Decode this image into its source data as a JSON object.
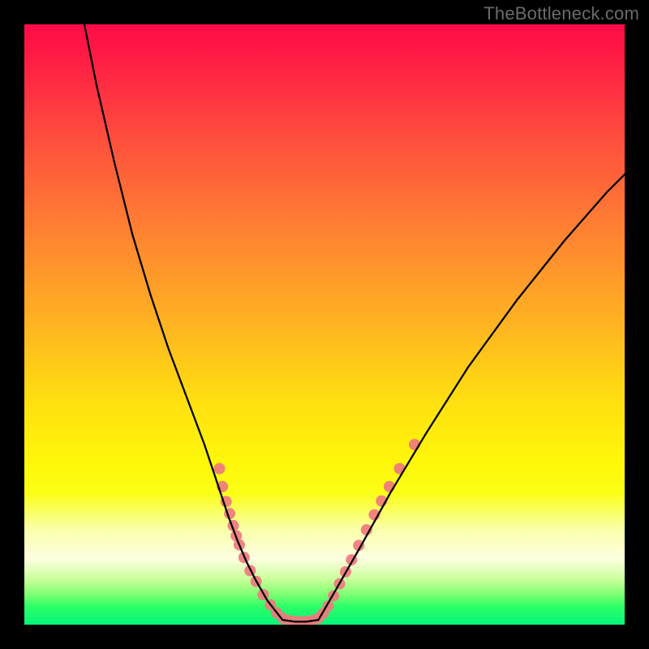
{
  "watermark": "TheBottleneck.com",
  "chart_data": {
    "type": "line",
    "title": "",
    "xlabel": "",
    "ylabel": "",
    "xlim": [
      0,
      100
    ],
    "ylim": [
      0,
      100
    ],
    "grid": false,
    "legend": false,
    "background_gradient": {
      "stops": [
        {
          "pos": 0,
          "color": "#ff0b47"
        },
        {
          "pos": 18,
          "color": "#ff4a3e"
        },
        {
          "pos": 48,
          "color": "#ffad24"
        },
        {
          "pos": 73,
          "color": "#fff70a"
        },
        {
          "pos": 89,
          "color": "#fdffe0"
        },
        {
          "pos": 100,
          "color": "#05f57a"
        }
      ]
    },
    "series": [
      {
        "name": "left-curve",
        "color": "#000000",
        "x": [
          10,
          12,
          15,
          18,
          21,
          24,
          27,
          30,
          32,
          34,
          35.5,
          37,
          38.5,
          40.5,
          43
        ],
        "y": [
          100,
          90,
          77,
          65,
          55,
          46,
          38,
          30,
          24,
          18,
          14,
          10.5,
          7.5,
          4,
          0.8
        ]
      },
      {
        "name": "valley-floor",
        "color": "#000000",
        "x": [
          43,
          45,
          47,
          49
        ],
        "y": [
          0.8,
          0.5,
          0.5,
          0.8
        ]
      },
      {
        "name": "right-curve",
        "color": "#000000",
        "x": [
          49,
          52,
          56,
          61,
          67,
          74,
          82,
          90,
          97,
          100
        ],
        "y": [
          0.8,
          6,
          13,
          22,
          32,
          43,
          54,
          64,
          72,
          75
        ]
      }
    ],
    "highlight_points": {
      "color": "#ef7a7d",
      "radius_px": 7,
      "points": [
        {
          "x": 32.5,
          "y": 26
        },
        {
          "x": 33.0,
          "y": 23
        },
        {
          "x": 33.6,
          "y": 20.5
        },
        {
          "x": 34.2,
          "y": 18.5
        },
        {
          "x": 34.8,
          "y": 16.5
        },
        {
          "x": 35.3,
          "y": 14.8
        },
        {
          "x": 35.8,
          "y": 13.3
        },
        {
          "x": 36.6,
          "y": 11.2
        },
        {
          "x": 37.6,
          "y": 9.0
        },
        {
          "x": 38.6,
          "y": 7.2
        },
        {
          "x": 39.8,
          "y": 5.0
        },
        {
          "x": 41.0,
          "y": 3.3
        },
        {
          "x": 42.0,
          "y": 2.0
        },
        {
          "x": 43.0,
          "y": 1.1
        },
        {
          "x": 44.0,
          "y": 0.7
        },
        {
          "x": 45.0,
          "y": 0.55
        },
        {
          "x": 46.0,
          "y": 0.5
        },
        {
          "x": 47.0,
          "y": 0.55
        },
        {
          "x": 48.0,
          "y": 0.7
        },
        {
          "x": 49.0,
          "y": 1.1
        },
        {
          "x": 49.8,
          "y": 1.9
        },
        {
          "x": 50.6,
          "y": 3.1
        },
        {
          "x": 51.5,
          "y": 4.8
        },
        {
          "x": 52.5,
          "y": 6.8
        },
        {
          "x": 53.5,
          "y": 8.8
        },
        {
          "x": 54.5,
          "y": 10.8
        },
        {
          "x": 55.7,
          "y": 13.2
        },
        {
          "x": 57.0,
          "y": 15.8
        },
        {
          "x": 58.3,
          "y": 18.3
        },
        {
          "x": 59.5,
          "y": 20.6
        },
        {
          "x": 60.8,
          "y": 23.0
        },
        {
          "x": 62.5,
          "y": 26.0
        },
        {
          "x": 65.0,
          "y": 30.0
        }
      ]
    }
  }
}
